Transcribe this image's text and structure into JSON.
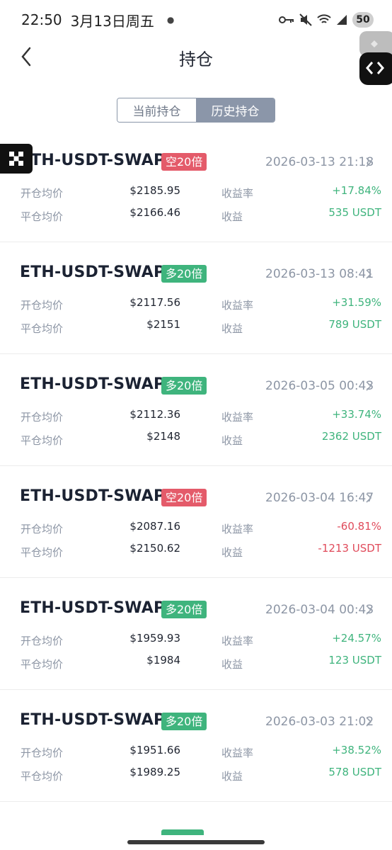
{
  "status": {
    "time": "22:50",
    "date": "3月13日周五",
    "battery": "50"
  },
  "header": {
    "title": "持仓"
  },
  "tabs": [
    {
      "label": "当前持仓",
      "active": false
    },
    {
      "label": "历史持仓",
      "active": true
    }
  ],
  "labels": {
    "open": "开仓均价",
    "close": "平仓均价",
    "rate": "收益率",
    "pnl": "收益"
  },
  "positions": [
    {
      "pair": "ETH-USDT-SWAP",
      "side": "short",
      "badge": "空20倍",
      "time": "2026-03-13 21:18",
      "open": "$2185.95",
      "close": "$2166.46",
      "rate": "+17.84%",
      "pnl": "535 USDT",
      "positive": true
    },
    {
      "pair": "ETH-USDT-SWAP",
      "side": "long",
      "badge": "多20倍",
      "time": "2026-03-13 08:41",
      "open": "$2117.56",
      "close": "$2151",
      "rate": "+31.59%",
      "pnl": "789 USDT",
      "positive": true
    },
    {
      "pair": "ETH-USDT-SWAP",
      "side": "long",
      "badge": "多20倍",
      "time": "2026-03-05 00:43",
      "open": "$2112.36",
      "close": "$2148",
      "rate": "+33.74%",
      "pnl": "2362 USDT",
      "positive": true
    },
    {
      "pair": "ETH-USDT-SWAP",
      "side": "short",
      "badge": "空20倍",
      "time": "2026-03-04 16:47",
      "open": "$2087.16",
      "close": "$2150.62",
      "rate": "-60.81%",
      "pnl": "-1213 USDT",
      "positive": false
    },
    {
      "pair": "ETH-USDT-SWAP",
      "side": "long",
      "badge": "多20倍",
      "time": "2026-03-04 00:43",
      "open": "$1959.93",
      "close": "$1984",
      "rate": "+24.57%",
      "pnl": "123 USDT",
      "positive": true
    },
    {
      "pair": "ETH-USDT-SWAP",
      "side": "long",
      "badge": "多20倍",
      "time": "2026-03-03 21:02",
      "open": "$1951.66",
      "close": "$1989.25",
      "rate": "+38.52%",
      "pnl": "578 USDT",
      "positive": true
    }
  ],
  "colors": {
    "long": "#3fb47d",
    "short": "#e45b6a",
    "positive": "#3fb47d",
    "negative": "#e04b5b",
    "tab_active": "#8b96a9"
  }
}
